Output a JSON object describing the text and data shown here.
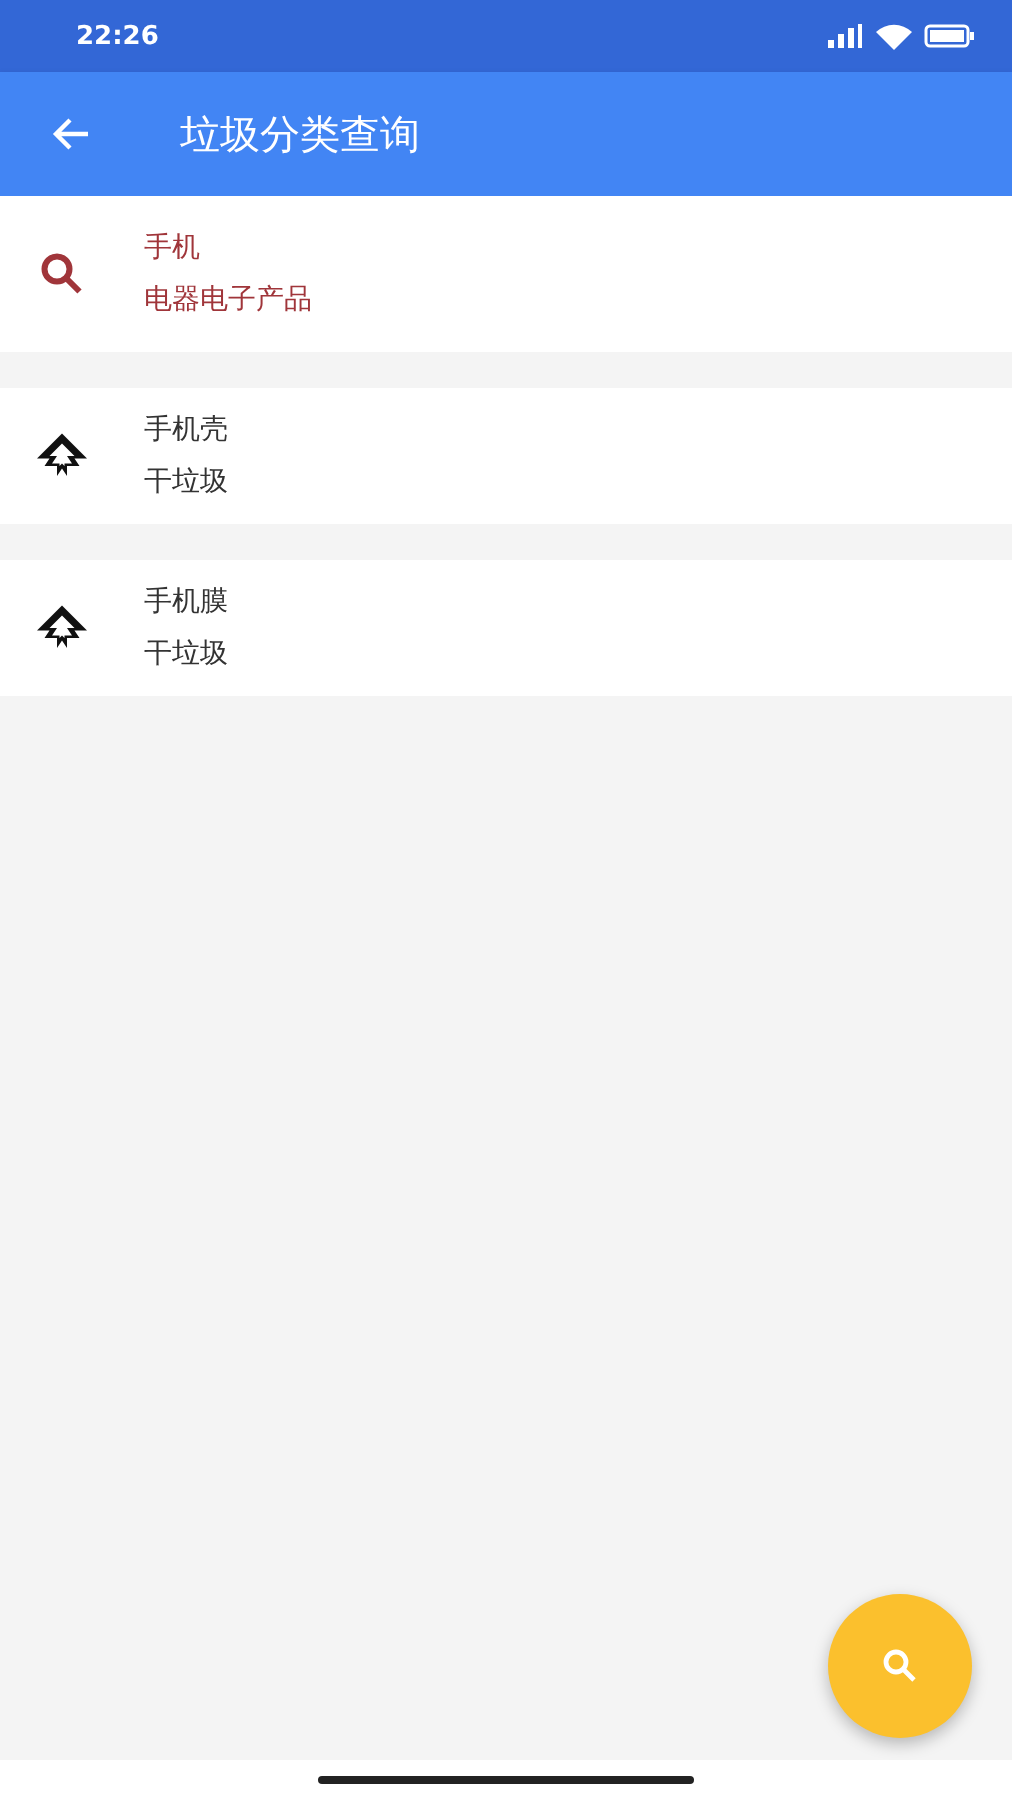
{
  "status_bar": {
    "time": "22:26"
  },
  "app_bar": {
    "title": "垃圾分类查询"
  },
  "items": [
    {
      "kind": "search",
      "name": "手机",
      "category": "电器电子产品"
    },
    {
      "kind": "result",
      "name": "手机壳",
      "category": "干垃圾"
    },
    {
      "kind": "result",
      "name": "手机膜",
      "category": "干垃圾"
    }
  ]
}
